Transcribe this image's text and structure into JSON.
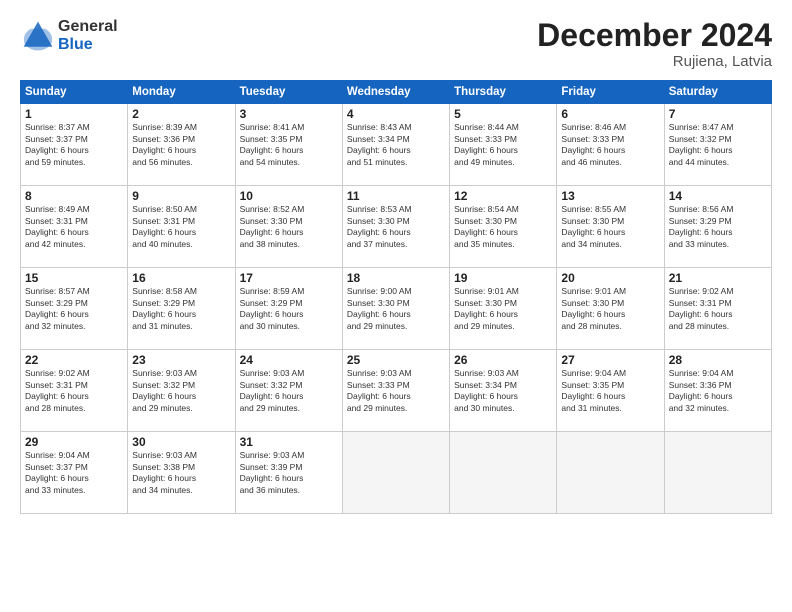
{
  "header": {
    "logo_general": "General",
    "logo_blue": "Blue",
    "month_title": "December 2024",
    "location": "Rujiena, Latvia"
  },
  "weekdays": [
    "Sunday",
    "Monday",
    "Tuesday",
    "Wednesday",
    "Thursday",
    "Friday",
    "Saturday"
  ],
  "days": [
    {
      "day": "",
      "empty": true
    },
    {
      "day": "",
      "empty": true
    },
    {
      "day": "",
      "empty": true
    },
    {
      "day": "",
      "empty": true
    },
    {
      "day": "",
      "empty": true
    },
    {
      "day": "",
      "empty": true
    },
    {
      "num": "1",
      "sunrise": "Sunrise: 8:37 AM",
      "sunset": "Sunset: 3:37 PM",
      "daylight": "Daylight: 6 hours and 59 minutes."
    },
    {
      "num": "2",
      "sunrise": "Sunrise: 8:39 AM",
      "sunset": "Sunset: 3:36 PM",
      "daylight": "Daylight: 6 hours and 56 minutes."
    },
    {
      "num": "3",
      "sunrise": "Sunrise: 8:41 AM",
      "sunset": "Sunset: 3:35 PM",
      "daylight": "Daylight: 6 hours and 54 minutes."
    },
    {
      "num": "4",
      "sunrise": "Sunrise: 8:43 AM",
      "sunset": "Sunset: 3:34 PM",
      "daylight": "Daylight: 6 hours and 51 minutes."
    },
    {
      "num": "5",
      "sunrise": "Sunrise: 8:44 AM",
      "sunset": "Sunset: 3:33 PM",
      "daylight": "Daylight: 6 hours and 49 minutes."
    },
    {
      "num": "6",
      "sunrise": "Sunrise: 8:46 AM",
      "sunset": "Sunset: 3:33 PM",
      "daylight": "Daylight: 6 hours and 46 minutes."
    },
    {
      "num": "7",
      "sunrise": "Sunrise: 8:47 AM",
      "sunset": "Sunset: 3:32 PM",
      "daylight": "Daylight: 6 hours and 44 minutes."
    },
    {
      "num": "8",
      "sunrise": "Sunrise: 8:49 AM",
      "sunset": "Sunset: 3:31 PM",
      "daylight": "Daylight: 6 hours and 42 minutes."
    },
    {
      "num": "9",
      "sunrise": "Sunrise: 8:50 AM",
      "sunset": "Sunset: 3:31 PM",
      "daylight": "Daylight: 6 hours and 40 minutes."
    },
    {
      "num": "10",
      "sunrise": "Sunrise: 8:52 AM",
      "sunset": "Sunset: 3:30 PM",
      "daylight": "Daylight: 6 hours and 38 minutes."
    },
    {
      "num": "11",
      "sunrise": "Sunrise: 8:53 AM",
      "sunset": "Sunset: 3:30 PM",
      "daylight": "Daylight: 6 hours and 37 minutes."
    },
    {
      "num": "12",
      "sunrise": "Sunrise: 8:54 AM",
      "sunset": "Sunset: 3:30 PM",
      "daylight": "Daylight: 6 hours and 35 minutes."
    },
    {
      "num": "13",
      "sunrise": "Sunrise: 8:55 AM",
      "sunset": "Sunset: 3:30 PM",
      "daylight": "Daylight: 6 hours and 34 minutes."
    },
    {
      "num": "14",
      "sunrise": "Sunrise: 8:56 AM",
      "sunset": "Sunset: 3:29 PM",
      "daylight": "Daylight: 6 hours and 33 minutes."
    },
    {
      "num": "15",
      "sunrise": "Sunrise: 8:57 AM",
      "sunset": "Sunset: 3:29 PM",
      "daylight": "Daylight: 6 hours and 32 minutes."
    },
    {
      "num": "16",
      "sunrise": "Sunrise: 8:58 AM",
      "sunset": "Sunset: 3:29 PM",
      "daylight": "Daylight: 6 hours and 31 minutes."
    },
    {
      "num": "17",
      "sunrise": "Sunrise: 8:59 AM",
      "sunset": "Sunset: 3:29 PM",
      "daylight": "Daylight: 6 hours and 30 minutes."
    },
    {
      "num": "18",
      "sunrise": "Sunrise: 9:00 AM",
      "sunset": "Sunset: 3:30 PM",
      "daylight": "Daylight: 6 hours and 29 minutes."
    },
    {
      "num": "19",
      "sunrise": "Sunrise: 9:01 AM",
      "sunset": "Sunset: 3:30 PM",
      "daylight": "Daylight: 6 hours and 29 minutes."
    },
    {
      "num": "20",
      "sunrise": "Sunrise: 9:01 AM",
      "sunset": "Sunset: 3:30 PM",
      "daylight": "Daylight: 6 hours and 28 minutes."
    },
    {
      "num": "21",
      "sunrise": "Sunrise: 9:02 AM",
      "sunset": "Sunset: 3:31 PM",
      "daylight": "Daylight: 6 hours and 28 minutes."
    },
    {
      "num": "22",
      "sunrise": "Sunrise: 9:02 AM",
      "sunset": "Sunset: 3:31 PM",
      "daylight": "Daylight: 6 hours and 28 minutes."
    },
    {
      "num": "23",
      "sunrise": "Sunrise: 9:03 AM",
      "sunset": "Sunset: 3:32 PM",
      "daylight": "Daylight: 6 hours and 29 minutes."
    },
    {
      "num": "24",
      "sunrise": "Sunrise: 9:03 AM",
      "sunset": "Sunset: 3:32 PM",
      "daylight": "Daylight: 6 hours and 29 minutes."
    },
    {
      "num": "25",
      "sunrise": "Sunrise: 9:03 AM",
      "sunset": "Sunset: 3:33 PM",
      "daylight": "Daylight: 6 hours and 29 minutes."
    },
    {
      "num": "26",
      "sunrise": "Sunrise: 9:03 AM",
      "sunset": "Sunset: 3:34 PM",
      "daylight": "Daylight: 6 hours and 30 minutes."
    },
    {
      "num": "27",
      "sunrise": "Sunrise: 9:04 AM",
      "sunset": "Sunset: 3:35 PM",
      "daylight": "Daylight: 6 hours and 31 minutes."
    },
    {
      "num": "28",
      "sunrise": "Sunrise: 9:04 AM",
      "sunset": "Sunset: 3:36 PM",
      "daylight": "Daylight: 6 hours and 32 minutes."
    },
    {
      "num": "29",
      "sunrise": "Sunrise: 9:04 AM",
      "sunset": "Sunset: 3:37 PM",
      "daylight": "Daylight: 6 hours and 33 minutes."
    },
    {
      "num": "30",
      "sunrise": "Sunrise: 9:03 AM",
      "sunset": "Sunset: 3:38 PM",
      "daylight": "Daylight: 6 hours and 34 minutes."
    },
    {
      "num": "31",
      "sunrise": "Sunrise: 9:03 AM",
      "sunset": "Sunset: 3:39 PM",
      "daylight": "Daylight: 6 hours and 36 minutes."
    },
    {
      "day": "",
      "empty": true
    },
    {
      "day": "",
      "empty": true
    },
    {
      "day": "",
      "empty": true
    },
    {
      "day": "",
      "empty": true
    },
    {
      "day": "",
      "empty": true
    }
  ]
}
